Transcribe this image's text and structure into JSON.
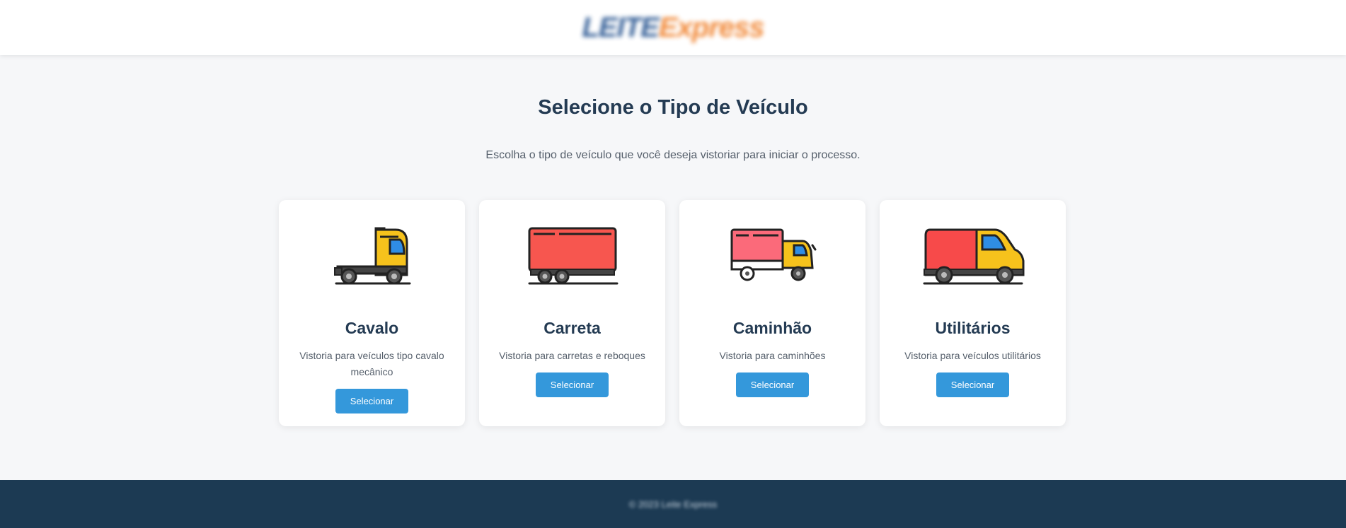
{
  "header": {
    "logo_part1": "LEITE",
    "logo_part2": "Express"
  },
  "main": {
    "title": "Selecione o Tipo de Veículo",
    "subtitle": "Escolha o tipo de veículo que você deseja vistoriar para iniciar o processo.",
    "cards": [
      {
        "name": "Cavalo",
        "description": "Vistoria para veículos tipo cavalo mecânico",
        "button": "Selecionar",
        "icon": "truck-tractor-icon"
      },
      {
        "name": "Carreta",
        "description": "Vistoria para carretas e reboques",
        "button": "Selecionar",
        "icon": "trailer-icon"
      },
      {
        "name": "Caminhão",
        "description": "Vistoria para caminhões",
        "button": "Selecionar",
        "icon": "truck-icon"
      },
      {
        "name": "Utilitários",
        "description": "Vistoria para veículos utilitários",
        "button": "Selecionar",
        "icon": "van-icon"
      }
    ]
  },
  "footer": {
    "copyright": "© 2023 Leite Express"
  },
  "colors": {
    "accent": "#3498db",
    "footer_bg": "#1c3a53",
    "title": "#243b53"
  }
}
